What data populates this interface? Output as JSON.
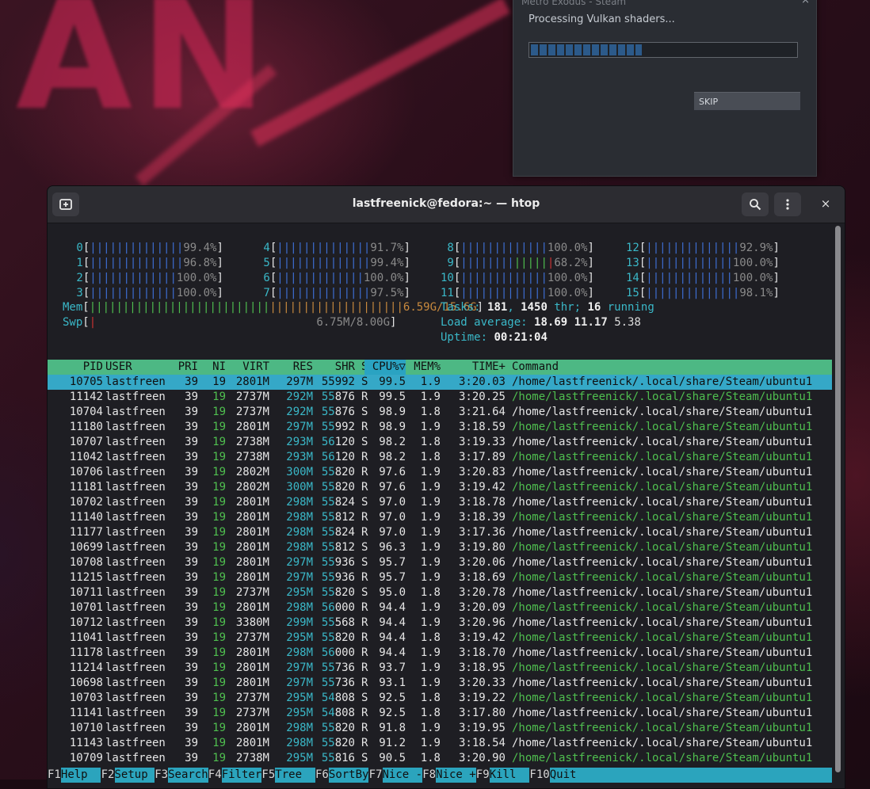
{
  "steam": {
    "title": "Metro Exodus - Steam",
    "close": "×",
    "message": "Processing Vulkan shaders...",
    "progress": 0.42,
    "skip_label": "SKIP"
  },
  "terminal": {
    "title": "lastfreenick@fedora:~ — htop",
    "new_tab_icon": "new-tab-icon",
    "search_icon": "search-icon",
    "menu_icon": "menu-icon",
    "close_label": "×"
  },
  "cpus_left": [
    {
      "id": "0",
      "pct": "99.4%"
    },
    {
      "id": "1",
      "pct": "96.8%"
    },
    {
      "id": "2",
      "pct": "100.0%"
    },
    {
      "id": "3",
      "pct": "100.0%"
    }
  ],
  "cpus_l2": [
    {
      "id": "4",
      "pct": "91.7%"
    },
    {
      "id": "5",
      "pct": "99.4%"
    },
    {
      "id": "6",
      "pct": "100.0%"
    },
    {
      "id": "7",
      "pct": "97.5%"
    }
  ],
  "cpus_r1": [
    {
      "id": "8",
      "pct": "100.0%"
    },
    {
      "id": "9",
      "pct": "68.2%"
    },
    {
      "id": "10",
      "pct": "100.0%"
    },
    {
      "id": "11",
      "pct": "100.0%"
    }
  ],
  "cpus_r2": [
    {
      "id": "12",
      "pct": "92.9%"
    },
    {
      "id": "13",
      "pct": "100.0%"
    },
    {
      "id": "14",
      "pct": "100.0%"
    },
    {
      "id": "15",
      "pct": "98.1%"
    }
  ],
  "mem": {
    "label": "Mem",
    "value": "6.59G/15.6G"
  },
  "swp": {
    "label": "Swp",
    "value": "6.75M/8.00G"
  },
  "tasks": {
    "label": "Tasks: ",
    "count": "181",
    "sep": ", ",
    "thr": "1450",
    "thr_label": " thr; ",
    "running": "16",
    "running_label": " running"
  },
  "load": {
    "label": "Load average: ",
    "v1": "18.69",
    "v2": "11.17",
    "v3": "5.38"
  },
  "uptime": {
    "label": "Uptime: ",
    "value": "00:21:04"
  },
  "columns": [
    "PID",
    "USER",
    "PRI",
    "NI",
    "VIRT",
    "RES",
    "SHR",
    "S",
    "CPU%▽",
    "MEM%",
    "TIME+",
    "Command"
  ],
  "rows": [
    [
      "10705",
      "lastfreen",
      "39",
      "19",
      "2801M",
      "297M",
      "55992",
      "S",
      "99.5",
      "1.9",
      "3:20.03",
      "/home/lastfreenick/.local/share/Steam/ubuntu1"
    ],
    [
      "11142",
      "lastfreen",
      "39",
      "19",
      "2737M",
      "292M",
      "55876",
      "R",
      "99.5",
      "1.9",
      "3:20.25",
      "/home/lastfreenick/.local/share/Steam/ubuntu1"
    ],
    [
      "10704",
      "lastfreen",
      "39",
      "19",
      "2737M",
      "292M",
      "55876",
      "S",
      "98.9",
      "1.8",
      "3:21.64",
      "/home/lastfreenick/.local/share/Steam/ubuntu1"
    ],
    [
      "11180",
      "lastfreen",
      "39",
      "19",
      "2801M",
      "297M",
      "55992",
      "R",
      "98.9",
      "1.9",
      "3:18.59",
      "/home/lastfreenick/.local/share/Steam/ubuntu1"
    ],
    [
      "10707",
      "lastfreen",
      "39",
      "19",
      "2738M",
      "293M",
      "56120",
      "S",
      "98.2",
      "1.8",
      "3:19.33",
      "/home/lastfreenick/.local/share/Steam/ubuntu1"
    ],
    [
      "11042",
      "lastfreen",
      "39",
      "19",
      "2738M",
      "293M",
      "56120",
      "R",
      "98.2",
      "1.8",
      "3:17.89",
      "/home/lastfreenick/.local/share/Steam/ubuntu1"
    ],
    [
      "10706",
      "lastfreen",
      "39",
      "19",
      "2802M",
      "300M",
      "55820",
      "R",
      "97.6",
      "1.9",
      "3:20.83",
      "/home/lastfreenick/.local/share/Steam/ubuntu1"
    ],
    [
      "11181",
      "lastfreen",
      "39",
      "19",
      "2802M",
      "300M",
      "55820",
      "R",
      "97.6",
      "1.9",
      "3:19.42",
      "/home/lastfreenick/.local/share/Steam/ubuntu1"
    ],
    [
      "10702",
      "lastfreen",
      "39",
      "19",
      "2801M",
      "298M",
      "55824",
      "S",
      "97.0",
      "1.9",
      "3:18.78",
      "/home/lastfreenick/.local/share/Steam/ubuntu1"
    ],
    [
      "11140",
      "lastfreen",
      "39",
      "19",
      "2801M",
      "298M",
      "55812",
      "R",
      "97.0",
      "1.9",
      "3:18.39",
      "/home/lastfreenick/.local/share/Steam/ubuntu1"
    ],
    [
      "11177",
      "lastfreen",
      "39",
      "19",
      "2801M",
      "298M",
      "55824",
      "R",
      "97.0",
      "1.9",
      "3:17.36",
      "/home/lastfreenick/.local/share/Steam/ubuntu1"
    ],
    [
      "10699",
      "lastfreen",
      "39",
      "19",
      "2801M",
      "298M",
      "55812",
      "S",
      "96.3",
      "1.9",
      "3:19.80",
      "/home/lastfreenick/.local/share/Steam/ubuntu1"
    ],
    [
      "10708",
      "lastfreen",
      "39",
      "19",
      "2801M",
      "297M",
      "55936",
      "S",
      "95.7",
      "1.9",
      "3:20.06",
      "/home/lastfreenick/.local/share/Steam/ubuntu1"
    ],
    [
      "11215",
      "lastfreen",
      "39",
      "19",
      "2801M",
      "297M",
      "55936",
      "R",
      "95.7",
      "1.9",
      "3:18.69",
      "/home/lastfreenick/.local/share/Steam/ubuntu1"
    ],
    [
      "10711",
      "lastfreen",
      "39",
      "19",
      "2737M",
      "295M",
      "55820",
      "S",
      "95.0",
      "1.8",
      "3:20.78",
      "/home/lastfreenick/.local/share/Steam/ubuntu1"
    ],
    [
      "10701",
      "lastfreen",
      "39",
      "19",
      "2801M",
      "298M",
      "56000",
      "R",
      "94.4",
      "1.9",
      "3:20.09",
      "/home/lastfreenick/.local/share/Steam/ubuntu1"
    ],
    [
      "10712",
      "lastfreen",
      "39",
      "19",
      "3380M",
      "299M",
      "55568",
      "R",
      "94.4",
      "1.9",
      "3:20.96",
      "/home/lastfreenick/.local/share/Steam/ubuntu1"
    ],
    [
      "11041",
      "lastfreen",
      "39",
      "19",
      "2737M",
      "295M",
      "55820",
      "R",
      "94.4",
      "1.8",
      "3:19.42",
      "/home/lastfreenick/.local/share/Steam/ubuntu1"
    ],
    [
      "11178",
      "lastfreen",
      "39",
      "19",
      "2801M",
      "298M",
      "56000",
      "R",
      "94.4",
      "1.9",
      "3:18.70",
      "/home/lastfreenick/.local/share/Steam/ubuntu1"
    ],
    [
      "11214",
      "lastfreen",
      "39",
      "19",
      "2801M",
      "297M",
      "55736",
      "R",
      "93.7",
      "1.9",
      "3:18.95",
      "/home/lastfreenick/.local/share/Steam/ubuntu1"
    ],
    [
      "10698",
      "lastfreen",
      "39",
      "19",
      "2801M",
      "297M",
      "55736",
      "R",
      "93.1",
      "1.9",
      "3:20.33",
      "/home/lastfreenick/.local/share/Steam/ubuntu1"
    ],
    [
      "10703",
      "lastfreen",
      "39",
      "19",
      "2737M",
      "295M",
      "54808",
      "S",
      "92.5",
      "1.8",
      "3:19.22",
      "/home/lastfreenick/.local/share/Steam/ubuntu1"
    ],
    [
      "11141",
      "lastfreen",
      "39",
      "19",
      "2737M",
      "295M",
      "54808",
      "R",
      "92.5",
      "1.8",
      "3:17.80",
      "/home/lastfreenick/.local/share/Steam/ubuntu1"
    ],
    [
      "10710",
      "lastfreen",
      "39",
      "19",
      "2801M",
      "298M",
      "55820",
      "R",
      "91.8",
      "1.9",
      "3:19.95",
      "/home/lastfreenick/.local/share/Steam/ubuntu1"
    ],
    [
      "11143",
      "lastfreen",
      "39",
      "19",
      "2801M",
      "298M",
      "55820",
      "R",
      "91.2",
      "1.9",
      "3:18.54",
      "/home/lastfreenick/.local/share/Steam/ubuntu1"
    ],
    [
      "10709",
      "lastfreen",
      "39",
      "19",
      "2738M",
      "295M",
      "55816",
      "S",
      "90.5",
      "1.8",
      "3:20.90",
      "/home/lastfreenick/.local/share/Steam/ubuntu1"
    ]
  ],
  "fkeys": [
    {
      "key": "F1",
      "label": "Help  "
    },
    {
      "key": "F2",
      "label": "Setup "
    },
    {
      "key": "F3",
      "label": "Search"
    },
    {
      "key": "F4",
      "label": "Filter"
    },
    {
      "key": "F5",
      "label": "Tree  "
    },
    {
      "key": "F6",
      "label": "SortBy"
    },
    {
      "key": "F7",
      "label": "Nice -"
    },
    {
      "key": "F8",
      "label": "Nice +"
    },
    {
      "key": "F9",
      "label": "Kill  "
    },
    {
      "key": "F10",
      "label": "Quit  "
    }
  ]
}
